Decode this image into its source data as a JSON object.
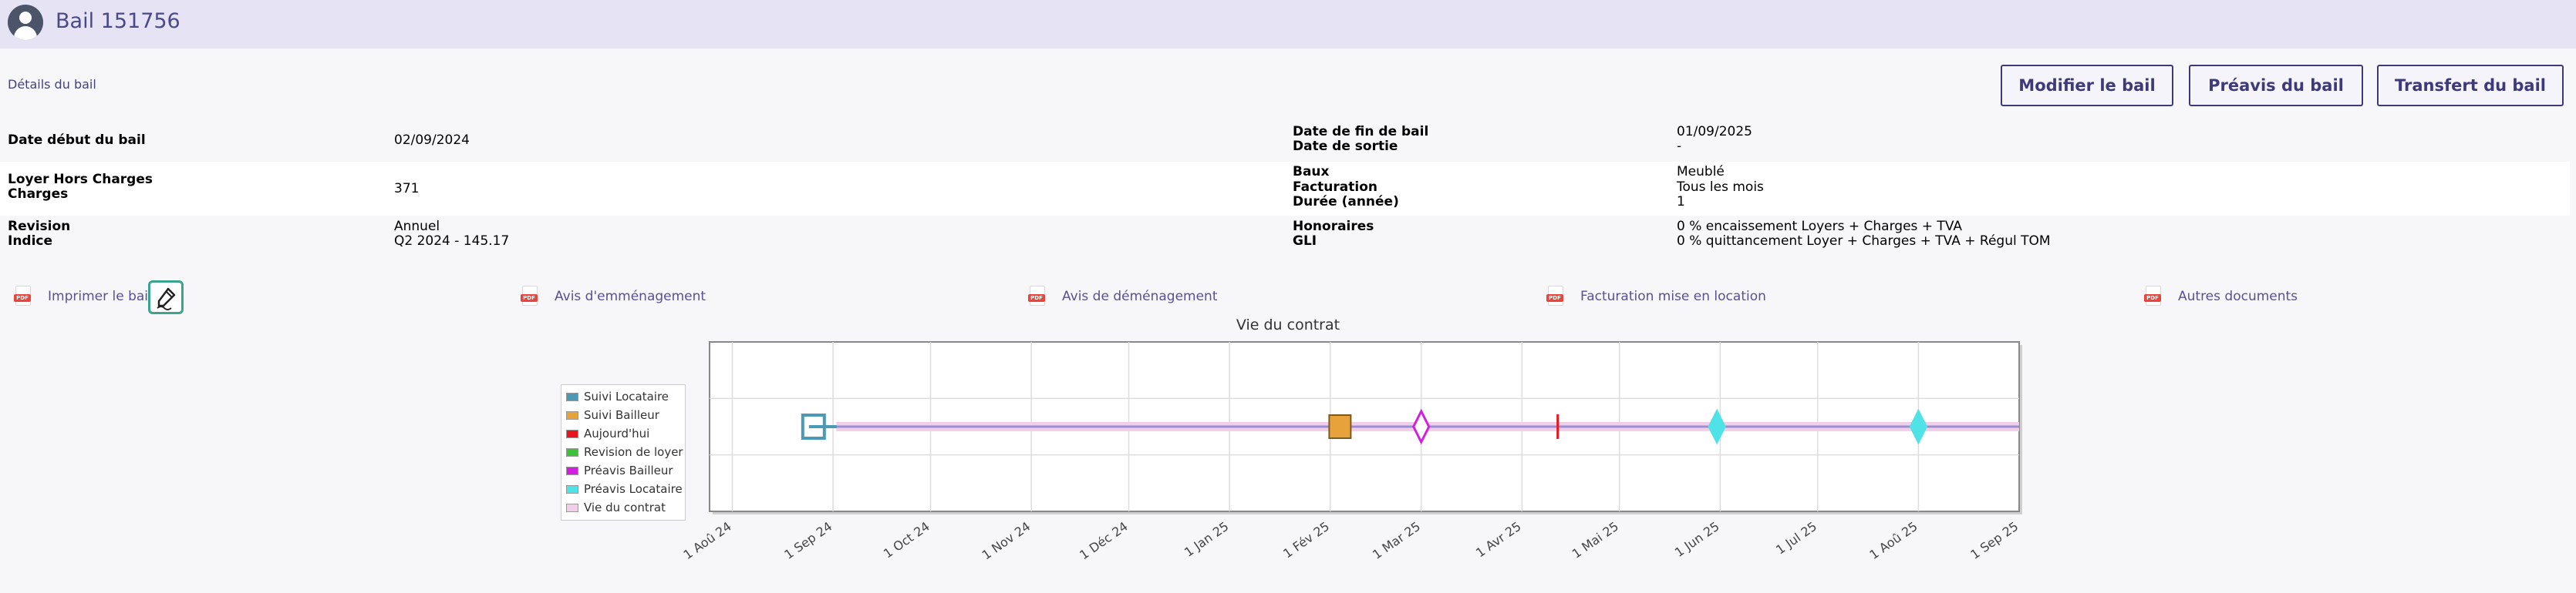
{
  "header": {
    "title": "Bail 151756"
  },
  "details": {
    "title": "Détails du bail"
  },
  "actions": {
    "modify": "Modifier le bail",
    "notice": "Préavis du bail",
    "transfer": "Transfert du bail"
  },
  "lease": {
    "left": [
      {
        "label": "Date début du bail",
        "value": "02/09/2024"
      },
      {
        "label": "Loyer Hors Charges",
        "value": "371"
      },
      {
        "label": "Charges",
        "value": ""
      },
      {
        "label": "Revision",
        "value": "Annuel"
      },
      {
        "label": "Indice",
        "value": "Q2 2024 - 145.17"
      }
    ],
    "right": [
      {
        "label": "Date de fin de bail",
        "value": "01/09/2025"
      },
      {
        "label": "Date de sortie",
        "value": "-"
      },
      {
        "label": "Baux",
        "value": "Meublé"
      },
      {
        "label": "Facturation",
        "value": "Tous les mois"
      },
      {
        "label": "Durée (année)",
        "value": "1"
      },
      {
        "label": "Honoraires",
        "value": "0 % encaissement Loyers + Charges + TVA"
      },
      {
        "label": "GLI",
        "value": "0 % quittancement Loyer + Charges + TVA + Régul TOM"
      }
    ]
  },
  "documents": {
    "pdf_tag": "PDF",
    "print": "Imprimer le bail",
    "move_in": "Avis d'emménagement",
    "move_out": "Avis de déménagement",
    "billing": "Facturation mise en location",
    "others": "Autres documents",
    "sign_icon": "pen-sign-icon"
  },
  "chart_data": {
    "type": "timeline",
    "title": "Vie du contrat",
    "x_ticks": [
      "1 Aoû 24",
      "1 Sep 24",
      "1 Oct 24",
      "1 Nov 24",
      "1 Déc 24",
      "1 Jan 25",
      "1 Fév 25",
      "1 Mar 25",
      "1 Avr 25",
      "1 Mai 25",
      "1 Jun 25",
      "1 Jul 25",
      "1 Aoû 25",
      "1 Sep 25"
    ],
    "x_range": [
      "2024-07-25",
      "2025-09-01"
    ],
    "grid": true,
    "legend_position": "left",
    "series": [
      {
        "name": "Suivi Locataire",
        "color": "#4a9ab5",
        "marker": "square",
        "points": [
          "2024-08-26"
        ]
      },
      {
        "name": "Suivi Bailleur",
        "color": "#e8a23c",
        "marker": "square",
        "points": [
          "2025-02-04"
        ]
      },
      {
        "name": "Aujourd'hui",
        "color": "#e8141e",
        "marker": "line",
        "points": [
          "2025-04-12"
        ]
      },
      {
        "name": "Revision de loyer",
        "color": "#3ec03a",
        "marker": "square",
        "points": []
      },
      {
        "name": "Préavis Bailleur",
        "color": "#d21ee0",
        "marker": "diamond",
        "points": [
          "2025-03-01"
        ]
      },
      {
        "name": "Préavis Locataire",
        "color": "#4fe3e8",
        "marker": "diamond",
        "points": [
          "2025-05-31",
          "2025-08-01"
        ]
      },
      {
        "name": "Vie du contrat",
        "color": "#f2cfe8",
        "marker": "band",
        "range": [
          "2024-09-02",
          "2025-09-01"
        ]
      }
    ]
  }
}
